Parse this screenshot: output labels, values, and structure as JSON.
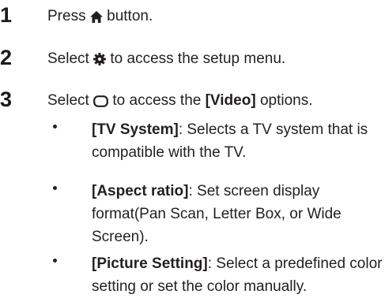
{
  "steps": [
    {
      "number": "1",
      "before": "Press",
      "icon": "home-icon",
      "after": "button."
    },
    {
      "number": "2",
      "before": "Select",
      "icon": "gear-icon",
      "after": "to access the setup menu."
    },
    {
      "number": "3",
      "before": "Select",
      "icon": "rounded-rectangle-icon",
      "after": "to access the",
      "bold": "[Video]",
      "after2": "options."
    }
  ],
  "bullets": [
    {
      "term": "[TV System]",
      "text": ": Selects a TV system that is compatible with the TV."
    },
    {
      "term": "[Aspect ratio]",
      "text": ": Set screen display format(Pan Scan, Letter Box, or Wide Screen)."
    },
    {
      "term": "[Picture Setting]",
      "text": ": Select a predefined color setting or set the color manually."
    }
  ]
}
